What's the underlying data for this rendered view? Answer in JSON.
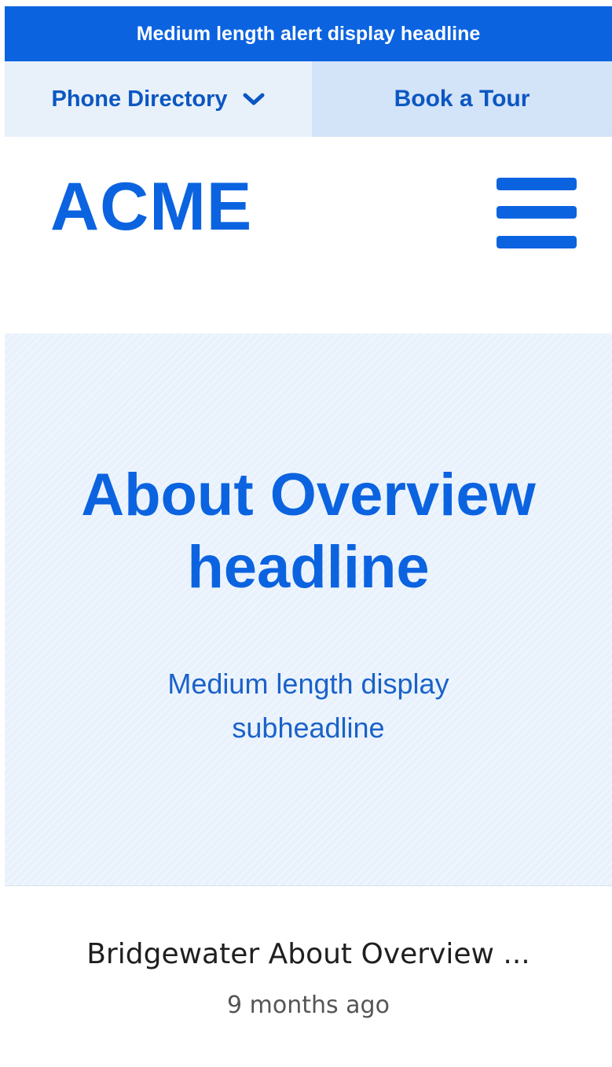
{
  "alert": {
    "text": "Medium length alert display headline"
  },
  "utility_nav": {
    "phone_directory_label": "Phone Directory",
    "book_tour_label": "Book a Tour"
  },
  "header": {
    "logo_text": "ACME",
    "menu_icon": "hamburger-menu-icon"
  },
  "hero": {
    "title_line1": "About Overview",
    "title_line2": "headline",
    "subtitle_line1": "Medium length display",
    "subtitle_line2": "subheadline"
  },
  "article_card": {
    "title": "Bridgewater About Overview ...",
    "timestamp": "9 months ago"
  },
  "colors": {
    "brand_blue": "#0b63e0",
    "hero_background": "#e9f2fc",
    "util_left_bg": "#e8f0fa",
    "util_right_bg": "#d3e3f8"
  }
}
